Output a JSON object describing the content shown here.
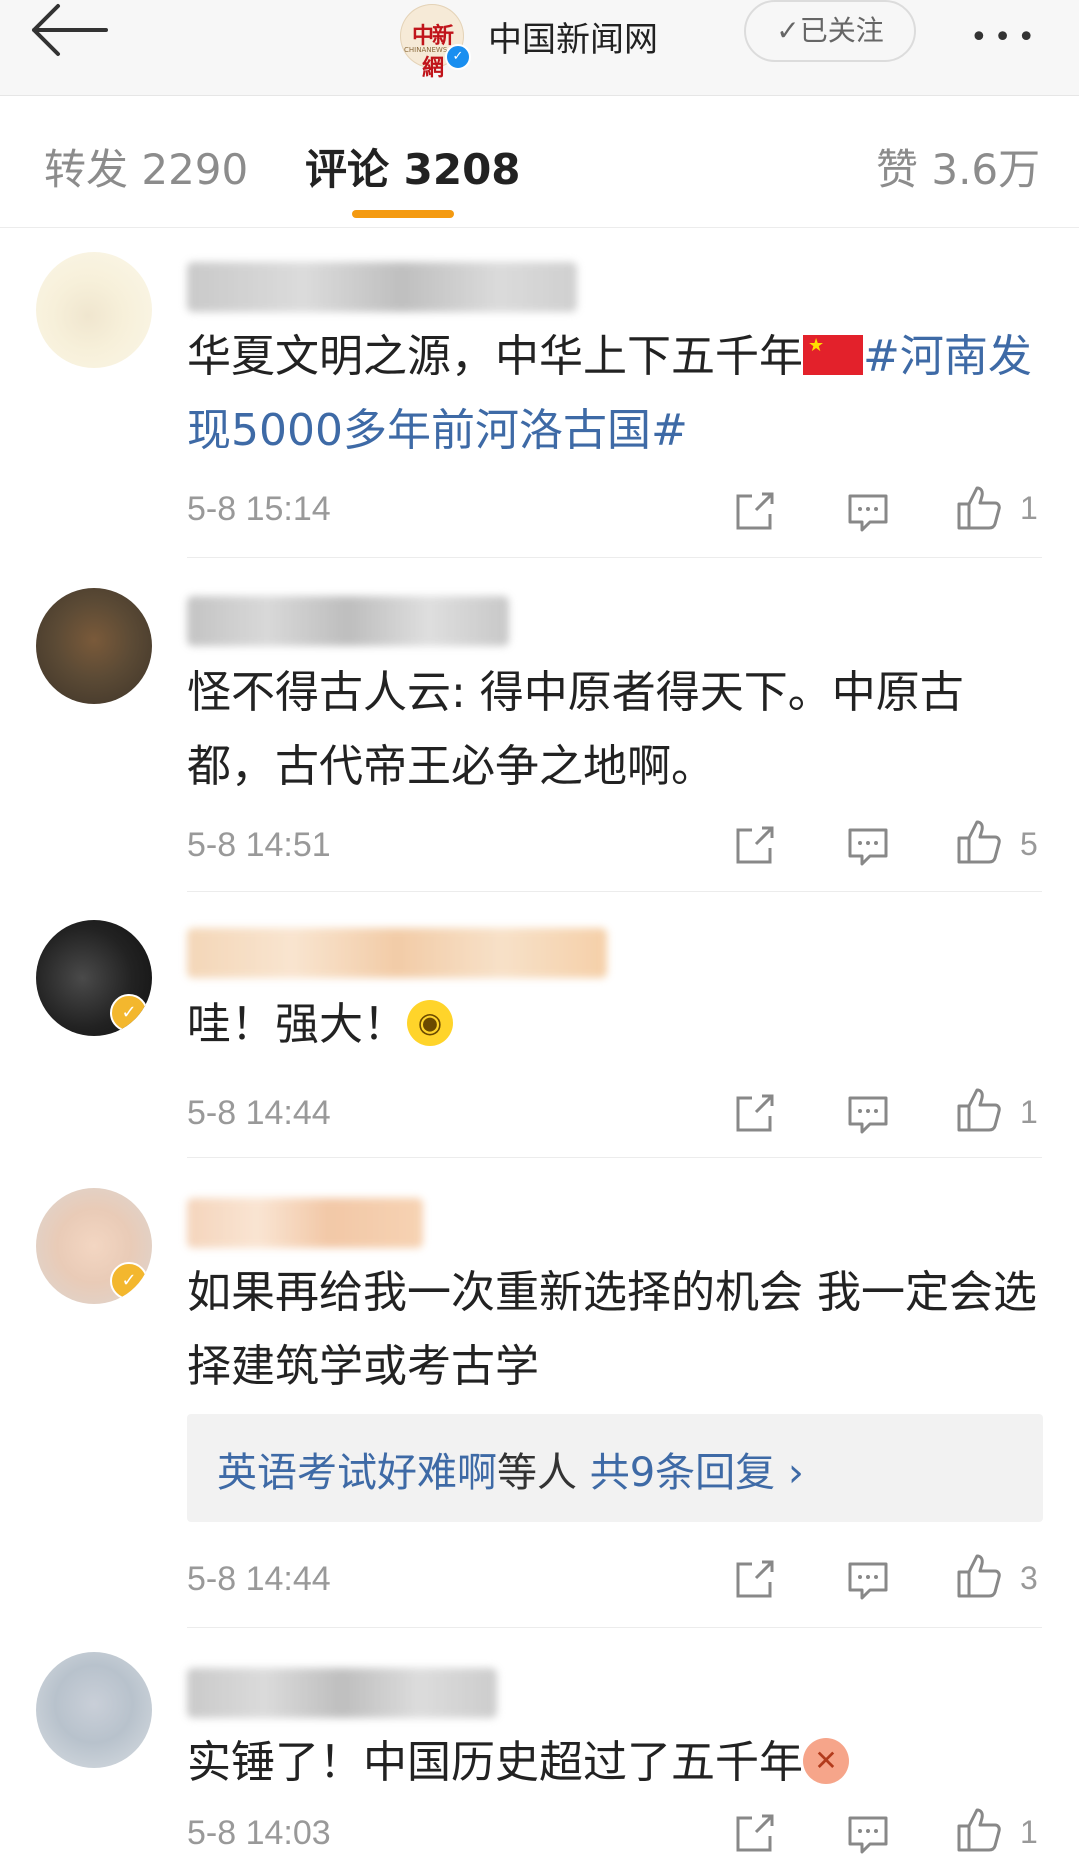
{
  "header": {
    "title": "中国新闻网",
    "logo_text": "中新網",
    "logo_subtext": "CHINANEWS.COM",
    "follow_label": "✓已关注",
    "verified_mark": "✓",
    "more_glyph": "•••"
  },
  "tabs": [
    {
      "label": "转发 2290",
      "active": false
    },
    {
      "label": "评论 3208",
      "active": true
    },
    {
      "label": "赞 3.6万",
      "active": false
    }
  ],
  "comments": [
    {
      "text_before": "华夏文明之源，中华上下五千年",
      "emoji": "china-flag",
      "hashtag": "#河南发现5000多年前河洛古国#",
      "time": "5-8 15:14",
      "likes": "1"
    },
    {
      "text": "怪不得古人云: 得中原者得天下。中原古都，古代帝王必争之地啊。",
      "time": "5-8 14:51",
      "likes": "5"
    },
    {
      "text": "哇！强大！",
      "emoji": "surprised-face",
      "time": "5-8 14:44",
      "likes": "1"
    },
    {
      "text": "如果再给我一次重新选择的机会 我一定会选择建筑学或考古学",
      "reply_user": "英语考试好难啊",
      "reply_mid": "等人",
      "reply_total": "共9条回复",
      "reply_chevron": "›",
      "time": "5-8 14:44",
      "likes": "3"
    },
    {
      "text": "实锤了！中国历史超过了五千年",
      "emoji": "angry-face",
      "time": "5-8 14:03",
      "likes": "1"
    }
  ],
  "colors": {
    "accent_tab": "#f49a11",
    "link_blue": "#3e6aa6",
    "muted": "#999999"
  },
  "icons": [
    "back-arrow-icon",
    "share-icon",
    "comment-icon",
    "like-icon",
    "verified-icon",
    "more-icon"
  ]
}
